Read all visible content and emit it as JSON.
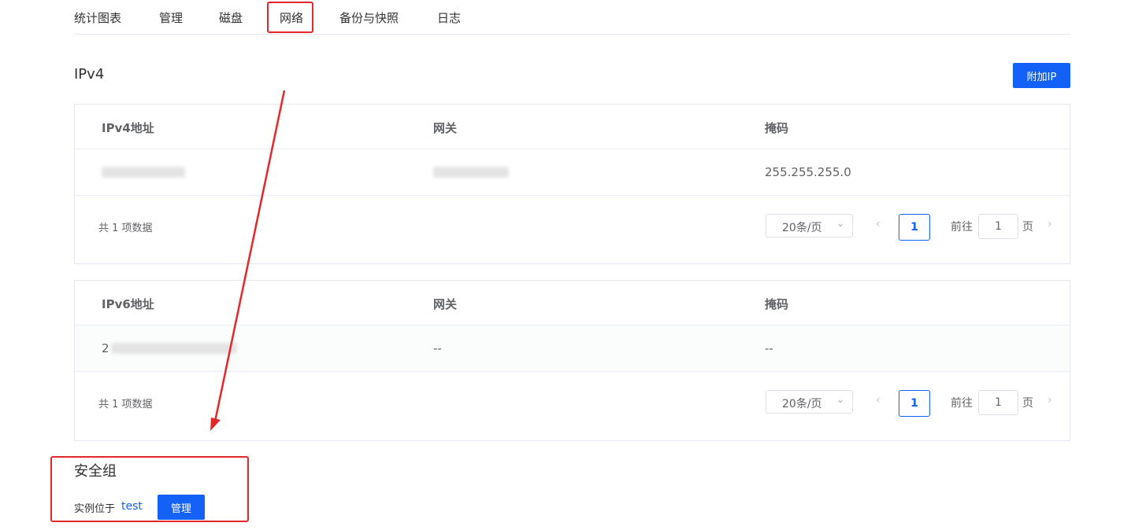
{
  "tabs": [
    "统计图表",
    "管理",
    "磁盘",
    "网络",
    "备份与快照",
    "日志"
  ],
  "active_tab": "网络",
  "ipv4": {
    "title": "IPv4",
    "add_button": "附加IP",
    "columns": [
      "IPv4地址",
      "网关",
      "掩码"
    ],
    "rows": [
      {
        "address": "",
        "gateway": "",
        "mask": "255.255.255.0"
      }
    ],
    "total": "共 1 项数据",
    "page_size": "20条/页",
    "current_page": "1",
    "goto_label": "前往",
    "goto_value": "1",
    "goto_suffix": "页"
  },
  "ipv6": {
    "columns": [
      "IPv6地址",
      "网关",
      "掩码"
    ],
    "rows": [
      {
        "address_prefix": "2",
        "gateway": "--",
        "mask": "--"
      }
    ],
    "total": "共 1 项数据",
    "page_size": "20条/页",
    "current_page": "1",
    "goto_label": "前往",
    "goto_value": "1",
    "goto_suffix": "页"
  },
  "security_group": {
    "title": "安全组",
    "instance_label": "实例位于",
    "instance_link": "test",
    "manage_button": "管理"
  },
  "icons": {
    "prev": "chevron-left-icon",
    "next": "chevron-right-icon",
    "select": "chevron-down-icon"
  },
  "colors": {
    "primary": "#1361f6",
    "annotation": "#e5272c"
  }
}
